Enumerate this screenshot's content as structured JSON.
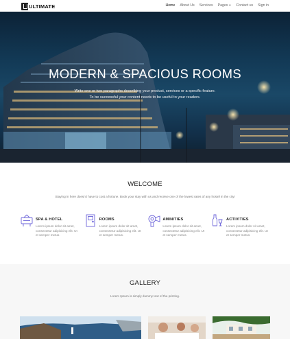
{
  "nav": {
    "logo_text": "ULTIMATE",
    "links": [
      {
        "label": "Home",
        "active": true
      },
      {
        "label": "About Us"
      },
      {
        "label": "Services"
      },
      {
        "label": "Pages"
      },
      {
        "label": "Contact us"
      },
      {
        "label": "Sign in"
      }
    ]
  },
  "hero": {
    "title": "MODERN & SPACIOUS ROOMS",
    "subtitle_line1": "Write one or two paragraphs describing your product, services or a specific feature.",
    "subtitle_line2": "To be successful your content needs to be useful to your readers."
  },
  "welcome": {
    "title": "WELCOME",
    "text": "Staying in here doesn't have to cost a fortune. Book your stay with us and receive one of the lowest rates of any hostel in the city!"
  },
  "features": [
    {
      "title": "SPA & HOTEL",
      "icon": "hotel-sign-icon",
      "text": "Lorem ipsum dolor sit amet, consectetur adipisicing elit. Ut et semper metus."
    },
    {
      "title": "ROOMS",
      "icon": "door-icon",
      "text": "Lorem ipsum dolor sit amet, consectetur adipisicing elit. Ut et semper metus."
    },
    {
      "title": "AMINITIES",
      "icon": "hair-dryer-icon",
      "text": "Lorem ipsum dolor sit amet, consectetur adipisicing elit. Ut et semper metus."
    },
    {
      "title": "ACTIVITIES",
      "icon": "bottle-glass-icon",
      "text": "Lorem ipsum dolor sit amet, consectetur adipisicing elit. Ut et semper metus."
    }
  ],
  "gallery": {
    "title": "GALLERY",
    "subtitle": "Lorem Ipsum is simply dummy text of the printing."
  },
  "colors": {
    "accent_icon": "#6b63d9",
    "hero_sky": "#123854"
  }
}
